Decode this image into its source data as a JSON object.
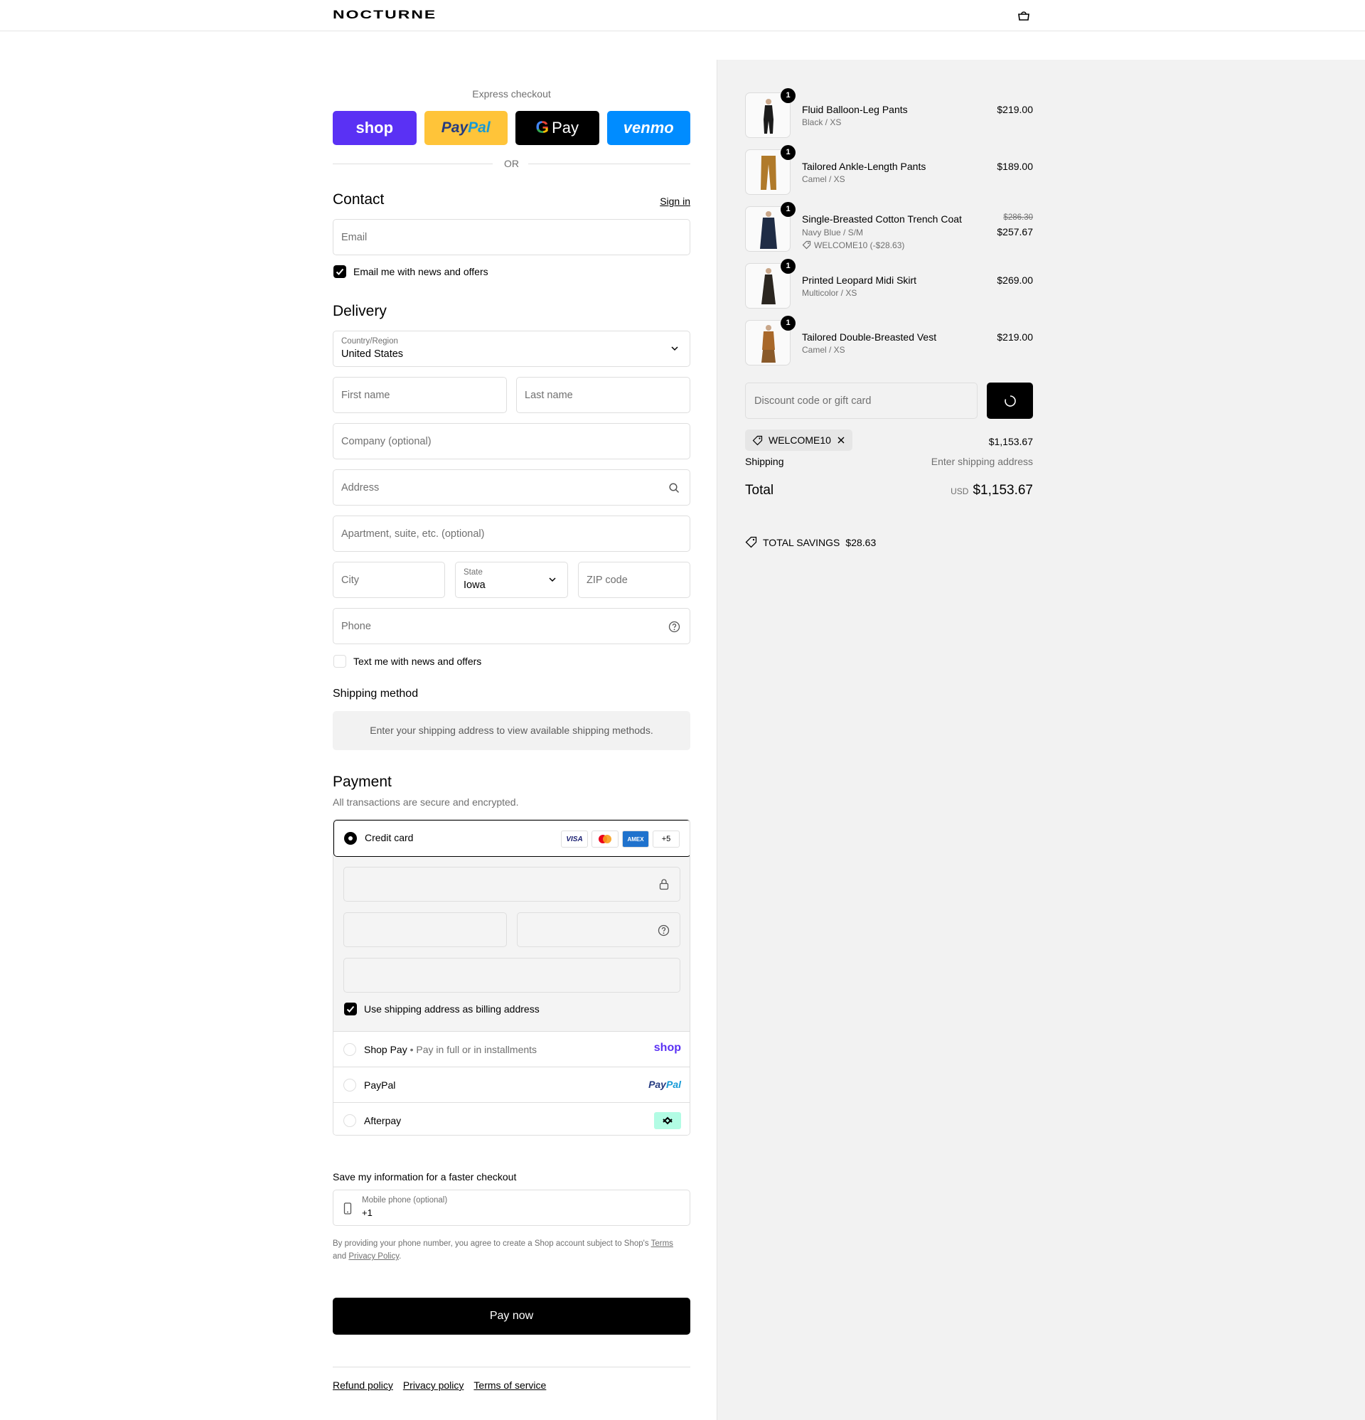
{
  "brand": "NOCTURNE",
  "express": {
    "title": "Express checkout",
    "shop_label": "shop",
    "paypal_label_a": "Pay",
    "paypal_label_b": "Pal",
    "gpay_g": "G",
    "gpay_label": "Pay",
    "venmo_label": "venmo",
    "or": "OR"
  },
  "contact": {
    "title": "Contact",
    "sign_in": "Sign in",
    "email_placeholder": "Email",
    "news_checkbox": "Email me with news and offers"
  },
  "delivery": {
    "title": "Delivery",
    "country_label": "Country/Region",
    "country_value": "United States",
    "first_name": "First name",
    "last_name": "Last name",
    "company": "Company (optional)",
    "address": "Address",
    "apartment": "Apartment, suite, etc. (optional)",
    "city": "City",
    "state_label": "State",
    "state_value": "Iowa",
    "zip": "ZIP code",
    "phone": "Phone",
    "text_checkbox": "Text me with news and offers"
  },
  "shipping_method": {
    "title": "Shipping method",
    "message": "Enter your shipping address to view available shipping methods."
  },
  "payment": {
    "title": "Payment",
    "subtitle": "All transactions are secure and encrypted.",
    "credit_card": "Credit card",
    "cards": [
      "VISA",
      "MC",
      "AMEX",
      "+5"
    ],
    "billing_checkbox": "Use shipping address as billing address",
    "shop_pay": "Shop Pay",
    "shop_pay_sep": "•",
    "shop_pay_note": "Pay in full or in installments",
    "shop_pay_logo": "shop",
    "paypal": "PayPal",
    "paypal_logo_a": "Pay",
    "paypal_logo_b": "Pal",
    "afterpay": "Afterpay"
  },
  "save_info": {
    "title": "Save my information for a faster checkout",
    "mobile_label": "Mobile phone (optional)",
    "mobile_value": "+1",
    "legal_prefix": "By providing your phone number, you agree to create a Shop account subject to Shop's",
    "terms": "Terms",
    "and": "and",
    "privacy": "Privacy Policy",
    "period": "."
  },
  "pay_now": "Pay now",
  "footer": [
    "Refund policy",
    "Privacy policy",
    "Terms of service"
  ],
  "cart": {
    "items": [
      {
        "qty": "1",
        "name": "Fluid Balloon-Leg Pants",
        "variant": "Black / XS",
        "price": "$219.00",
        "color": "#1b1b1b"
      },
      {
        "qty": "1",
        "name": "Tailored Ankle-Length Pants",
        "variant": "Camel / XS",
        "price": "$189.00",
        "color": "#b07a2a"
      },
      {
        "qty": "1",
        "name": "Single-Breasted Cotton Trench Coat",
        "variant": "Navy Blue / S/M",
        "discount": "WELCOME10 (-$28.63)",
        "old_price": "$286.30",
        "price": "$257.67",
        "color": "#1f2c45"
      },
      {
        "qty": "1",
        "name": "Printed Leopard Midi Skirt",
        "variant": "Multicolor / XS",
        "price": "$269.00",
        "color": "#2b2620"
      },
      {
        "qty": "1",
        "name": "Tailored Double-Breasted Vest",
        "variant": "Camel / XS",
        "price": "$219.00",
        "color": "#a8682a"
      }
    ],
    "discount_placeholder": "Discount code or gift card",
    "applied_code": "WELCOME10",
    "subtotal": "$1,153.67",
    "shipping_label": "Shipping",
    "shipping_value": "Enter shipping address",
    "total_label": "Total",
    "currency": "USD",
    "total": "$1,153.67",
    "savings_label": "TOTAL SAVINGS",
    "savings_value": "$28.63"
  },
  "colors": {
    "shop_purple": "#5a31f4",
    "paypal_yellow": "#ffc439",
    "venmo_blue": "#008cff",
    "afterpay_mint": "#b2fce4"
  }
}
